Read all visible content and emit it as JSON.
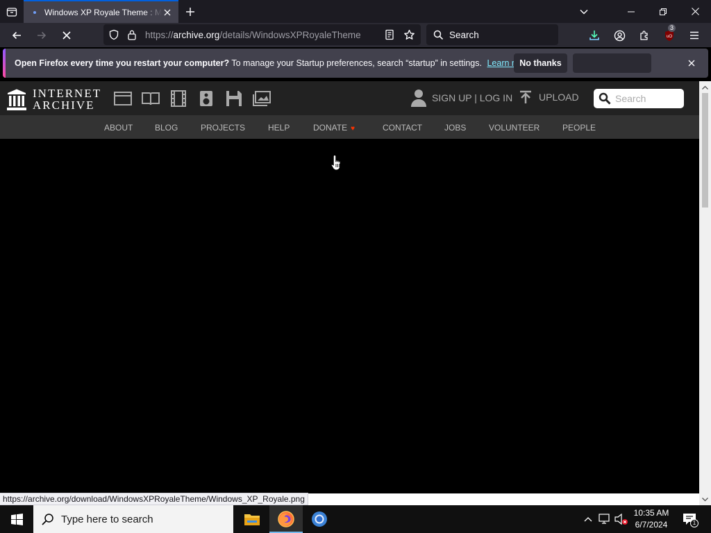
{
  "browser": {
    "tab": {
      "title": "Windows XP Royale Theme : Microsoft : Free Download, Borrow, and Streaming : Internet Archive"
    },
    "url": {
      "prefix": "https://",
      "host": "archive.org",
      "path": "/details/WindowsXPRoyaleTheme"
    },
    "search_label": "Search",
    "extension_badge": "3",
    "status_link": "https://archive.org/download/WindowsXPRoyaleTheme/Windows_XP_Royale.png"
  },
  "notification": {
    "bold_text": "Open Firefox every time you restart your computer?",
    "text": "To manage your Startup preferences, search “startup” in settings.",
    "learn_more": "Learn more",
    "no_thanks": "No thanks"
  },
  "site": {
    "logo_line1": "INTERNET",
    "logo_line2": "ARCHIVE",
    "auth_label": "SIGN UP | LOG IN",
    "upload_label": "UPLOAD",
    "search_placeholder": "Search",
    "nav": [
      "ABOUT",
      "BLOG",
      "PROJECTS",
      "HELP",
      "DONATE",
      "CONTACT",
      "JOBS",
      "VOLUNTEER",
      "PEOPLE"
    ]
  },
  "taskbar": {
    "search_placeholder": "Type here to search",
    "time": "10:35 AM",
    "date": "6/7/2024",
    "notification_count": "1"
  },
  "colors": {
    "accent": "#0060df",
    "page_bg": "#000000",
    "ia_header": "#222222",
    "ia_nav": "#333333"
  }
}
